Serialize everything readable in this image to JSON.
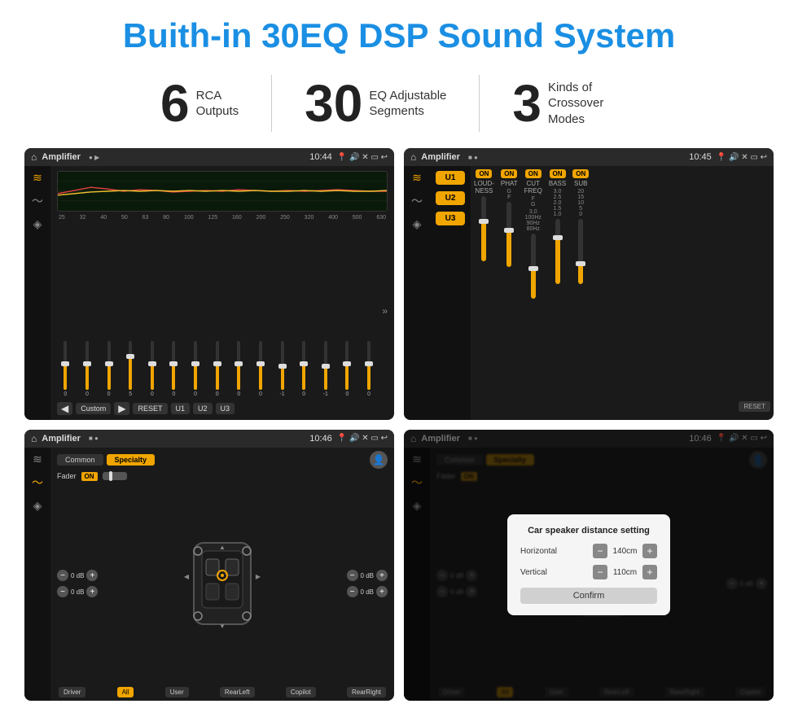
{
  "title": "Buith-in 30EQ DSP Sound System",
  "stats": [
    {
      "number": "6",
      "label": "RCA\nOutputs"
    },
    {
      "number": "30",
      "label": "EQ Adjustable\nSegments"
    },
    {
      "number": "3",
      "label": "Kinds of\nCrossover Modes"
    }
  ],
  "screens": [
    {
      "id": "eq-screen",
      "statusBar": {
        "appName": "Amplifier",
        "time": "10:44"
      },
      "type": "eq"
    },
    {
      "id": "amp-screen",
      "statusBar": {
        "appName": "Amplifier",
        "time": "10:45"
      },
      "type": "amp"
    },
    {
      "id": "fader-screen",
      "statusBar": {
        "appName": "Amplifier",
        "time": "10:46"
      },
      "type": "fader"
    },
    {
      "id": "dialog-screen",
      "statusBar": {
        "appName": "Amplifier",
        "time": "10:46"
      },
      "type": "dialog"
    }
  ],
  "eq": {
    "frequencies": [
      "25",
      "32",
      "40",
      "50",
      "63",
      "80",
      "100",
      "125",
      "160",
      "200",
      "250",
      "320",
      "400",
      "500",
      "630"
    ],
    "values": [
      "0",
      "0",
      "0",
      "5",
      "0",
      "0",
      "0",
      "0",
      "0",
      "0",
      "-1",
      "0",
      "-1",
      "0",
      "0"
    ],
    "presetLabel": "Custom",
    "buttons": [
      "U1",
      "U2",
      "U3",
      "RESET"
    ]
  },
  "amp": {
    "channels": [
      "U1",
      "U2",
      "U3"
    ],
    "controls": [
      {
        "label": "LOUDNESS",
        "on": true
      },
      {
        "label": "PHAT",
        "on": true
      },
      {
        "label": "CUT FREQ",
        "on": true
      },
      {
        "label": "BASS",
        "on": true
      },
      {
        "label": "SUB",
        "on": true
      }
    ],
    "resetLabel": "RESET"
  },
  "fader": {
    "tabs": [
      "Common",
      "Specialty"
    ],
    "activeTab": "Specialty",
    "faderLabel": "Fader",
    "onLabel": "ON",
    "dbValues": [
      "0 dB",
      "0 dB",
      "0 dB",
      "0 dB"
    ],
    "bottomButtons": [
      "Driver",
      "All",
      "User",
      "RearLeft",
      "RearRight",
      "Copilot"
    ]
  },
  "dialog": {
    "title": "Car speaker distance setting",
    "horizontal": {
      "label": "Horizontal",
      "value": "140cm"
    },
    "vertical": {
      "label": "Vertical",
      "value": "110cm"
    },
    "confirmLabel": "Confirm",
    "tabs": [
      "Common",
      "Specialty"
    ],
    "activeTab": "Specialty",
    "faderLabel": "Fader",
    "onLabel": "ON",
    "dbValues": [
      "0 dB",
      "0 dB"
    ],
    "bottomButtons": [
      "Driver",
      "RearLeft",
      "User",
      "RearRight",
      "Copilot"
    ]
  }
}
